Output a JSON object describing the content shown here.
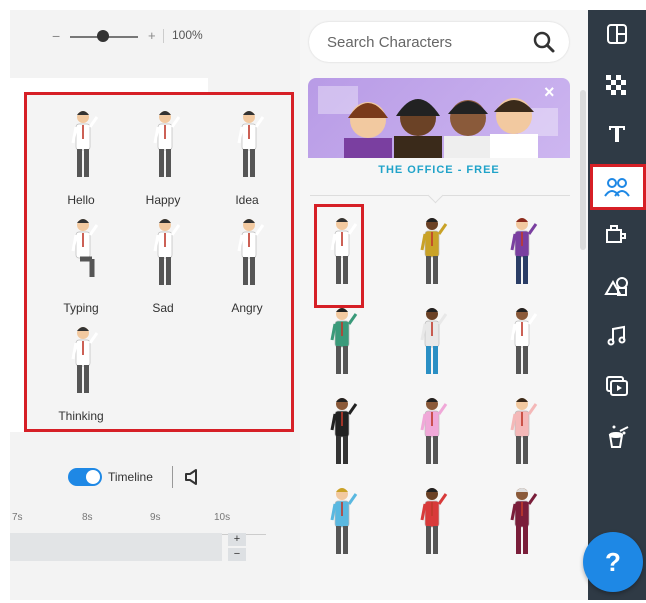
{
  "zoom": {
    "minus": "−",
    "plus": "+",
    "level": "100%"
  },
  "poses": [
    {
      "label": "Hello"
    },
    {
      "label": "Happy"
    },
    {
      "label": "Idea"
    },
    {
      "label": "Typing"
    },
    {
      "label": "Sad"
    },
    {
      "label": "Angry"
    },
    {
      "label": "Thinking"
    }
  ],
  "timeline": {
    "label": "Timeline",
    "ticks": [
      "7s",
      "8s",
      "9s",
      "10s"
    ],
    "plus": "+",
    "minus": "−"
  },
  "search": {
    "placeholder": "Search Characters",
    "icon": "search-icon"
  },
  "banner": {
    "title": "THE OFFICE - FREE",
    "close": "×"
  },
  "characters": [
    {
      "shirt": "#ffffff",
      "pants": "#555555",
      "skin": "#f2c9a0",
      "hair": "#333333"
    },
    {
      "shirt": "#c9a227",
      "pants": "#555555",
      "skin": "#6b4226",
      "hair": "#222222"
    },
    {
      "shirt": "#7a3fa0",
      "pants": "#2a3d66",
      "skin": "#f2c9a0",
      "hair": "#8b2b1e"
    },
    {
      "shirt": "#3a9a7a",
      "pants": "#555555",
      "skin": "#f2c9a0",
      "hair": "#222222"
    },
    {
      "shirt": "#e8e8e8",
      "pants": "#2a8fc4",
      "skin": "#6b4226",
      "hair": "#222222"
    },
    {
      "shirt": "#ffffff",
      "pants": "#555555",
      "skin": "#8a5a3a",
      "hair": "#222222"
    },
    {
      "shirt": "#222222",
      "pants": "#333333",
      "skin": "#8a5a3a",
      "hair": "#222222"
    },
    {
      "shirt": "#f0a8d8",
      "pants": "#555555",
      "skin": "#8a5a3a",
      "hair": "#222222"
    },
    {
      "shirt": "#f4b8b8",
      "pants": "#555555",
      "skin": "#f2c9a0",
      "hair": "#3a2a1a"
    },
    {
      "shirt": "#5ab8e0",
      "pants": "#555555",
      "skin": "#f2c9a0",
      "hair": "#c9a227"
    },
    {
      "shirt": "#d83a3a",
      "pants": "#555555",
      "skin": "#6b4226",
      "hair": "#222222"
    },
    {
      "shirt": "#7a1e3a",
      "pants": "#7a1e3a",
      "skin": "#8a5a3a",
      "hair": "#dddddd"
    }
  ],
  "sidebar": [
    {
      "icon": "layout-icon"
    },
    {
      "icon": "background-icon"
    },
    {
      "icon": "text-icon"
    },
    {
      "icon": "characters-icon",
      "active": true
    },
    {
      "icon": "props-icon"
    },
    {
      "icon": "shapes-icon"
    },
    {
      "icon": "music-icon"
    },
    {
      "icon": "video-icon"
    },
    {
      "icon": "effects-icon"
    }
  ],
  "help": {
    "label": "?"
  },
  "colors": {
    "accent": "#1e88e5",
    "highlight": "#d61f26",
    "sidebar": "#2f3a45",
    "banner_title": "#20a3c9"
  }
}
